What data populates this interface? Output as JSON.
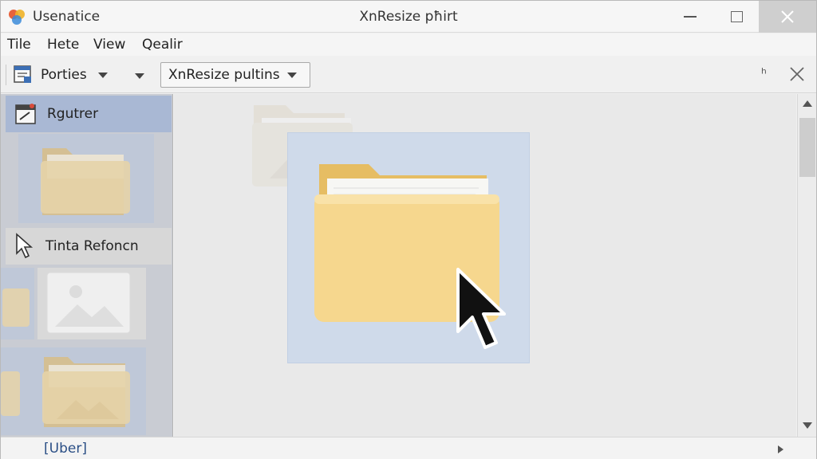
{
  "titlebar": {
    "app_name": "Usenatice",
    "window_title": "XnResize pħirt"
  },
  "menu": {
    "items": [
      "Tile",
      "Hete",
      "View",
      "Qealir"
    ]
  },
  "toolbar": {
    "properties_label": "Porties",
    "preset_select_value": "XnResize pultins",
    "right_glyph": "ʰ"
  },
  "sidebar": {
    "items": [
      {
        "label": "Rgutrer",
        "icon": "calendar-edit-icon"
      },
      {
        "label": "Tinta Refoncn",
        "icon": "pointer-icon"
      }
    ]
  },
  "statusbar": {
    "text": "[Uber]"
  },
  "colors": {
    "sidebar_selected": "#a9b8d4",
    "selection_fill": "#cfdaea",
    "folder_body": "#f6d78e",
    "folder_back": "#e6bd63",
    "status_text": "#2b4f86"
  }
}
